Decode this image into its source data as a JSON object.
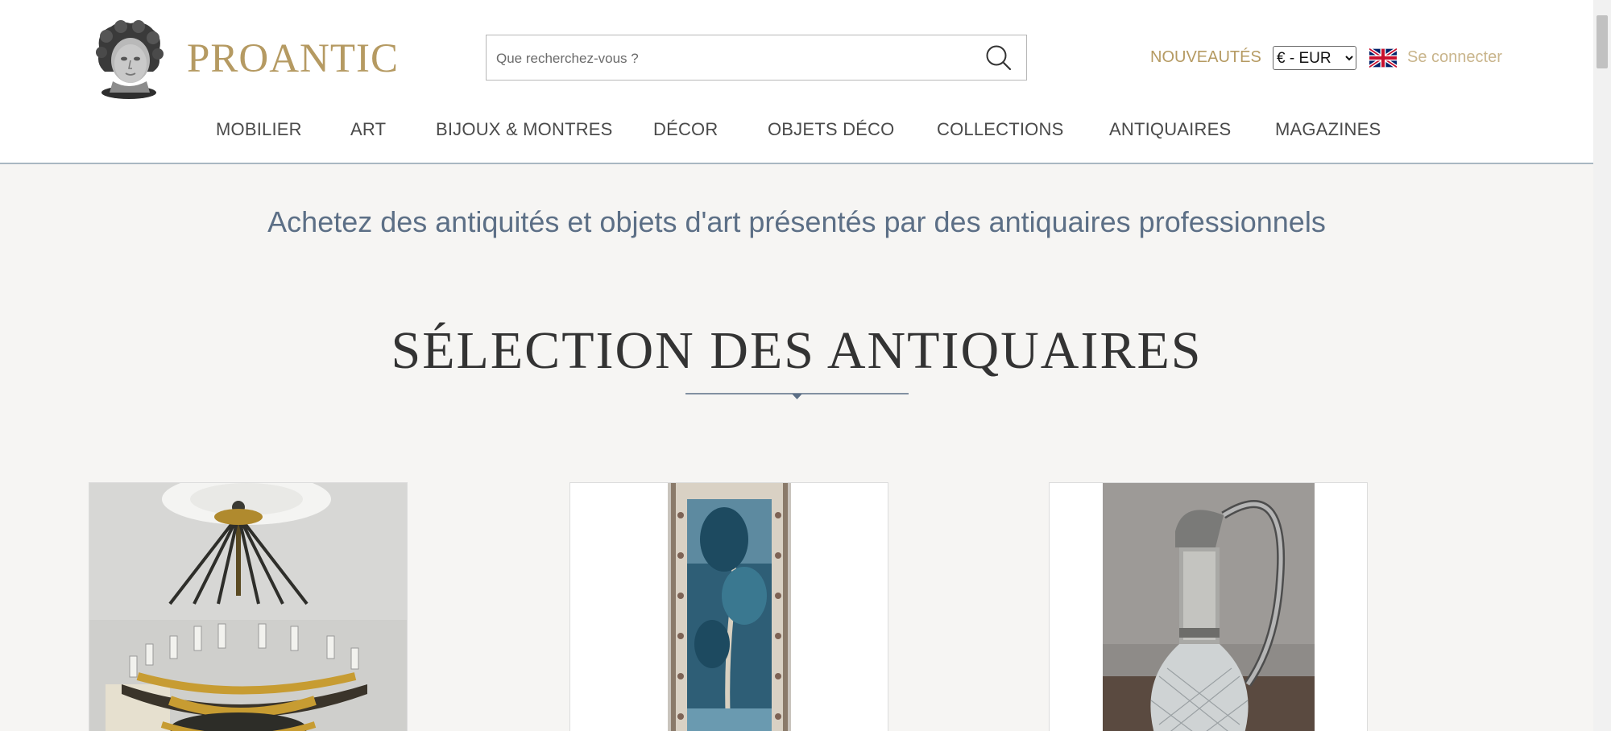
{
  "header": {
    "brand": "PROANTIC",
    "search_placeholder": "Que recherchez-vous ?",
    "new_link": "NOUVEAUTÉS",
    "currency_selected": "€ - EUR",
    "signin": "Se connecter"
  },
  "nav": [
    "MOBILIER",
    "ART",
    "BIJOUX & MONTRES",
    "DÉCOR",
    "OBJETS DÉCO",
    "COLLECTIONS",
    "ANTIQUAIRES",
    "MAGAZINES"
  ],
  "main": {
    "tagline": "Achetez des antiquités et objets d'art présentés par des antiquaires professionnels",
    "section_title": "SÉLECTION DES ANTIQUAIRES"
  },
  "cards": [
    {
      "subject": "chandelier"
    },
    {
      "subject": "tapestry"
    },
    {
      "subject": "ewer"
    }
  ],
  "colors": {
    "brand_gold": "#b59a62",
    "tagline_blue": "#5c6f86",
    "page_bg": "#f6f5f3"
  },
  "icons": [
    "search-icon",
    "uk-flag-icon",
    "chevron-down-icon"
  ]
}
